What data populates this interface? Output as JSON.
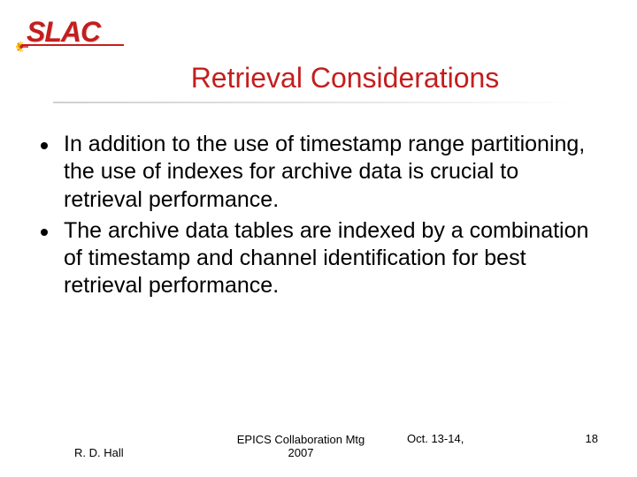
{
  "logo": {
    "text": "SLAC"
  },
  "title": "Retrieval Considerations",
  "bullets": [
    "In addition to the use of timestamp range partitioning, the use of indexes for archive data is crucial to retrieval performance.",
    "The archive data tables are indexed by a combination of timestamp and channel identification for best retrieval performance."
  ],
  "footer": {
    "author": "R. D. Hall",
    "event_line1": "EPICS Collaboration Mtg",
    "event_line2": "2007",
    "date": "Oct. 13-14,",
    "page": "18"
  }
}
